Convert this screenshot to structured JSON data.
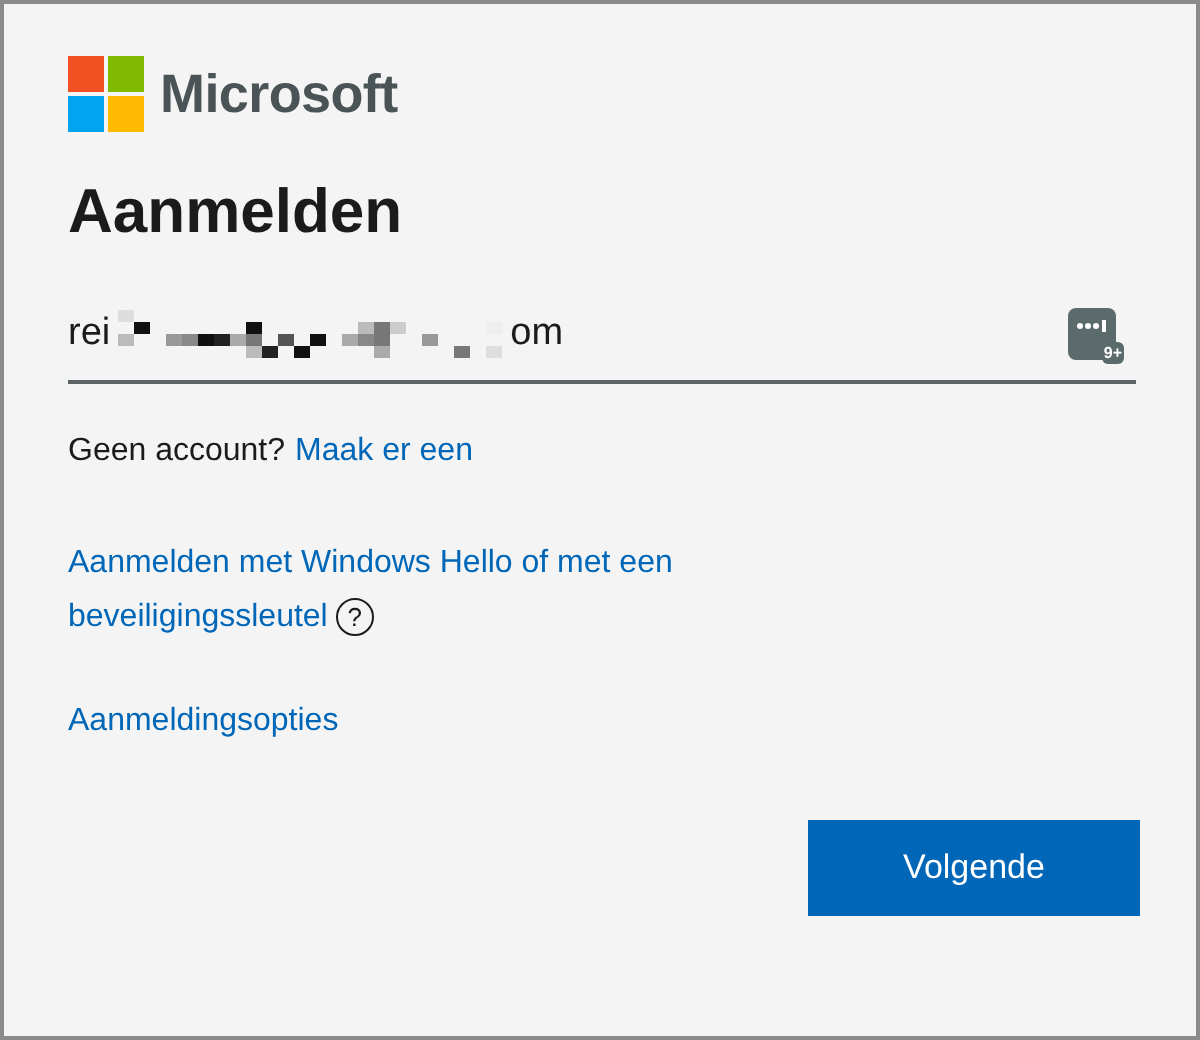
{
  "brand": {
    "name": "Microsoft"
  },
  "heading": "Aanmelden",
  "email_field": {
    "value_start": "rei",
    "value_end": "om",
    "badge": "9+"
  },
  "no_account": {
    "text": "Geen account?",
    "link": "Maak er een"
  },
  "windows_hello": {
    "link_lines": [
      "Aanmelden met Windows Hello of met een",
      "beveiligingssleutel"
    ],
    "help": "?"
  },
  "options_link": "Aanmeldingsopties",
  "buttons": [
    {
      "label": "Volgende",
      "kind": "primary"
    }
  ]
}
